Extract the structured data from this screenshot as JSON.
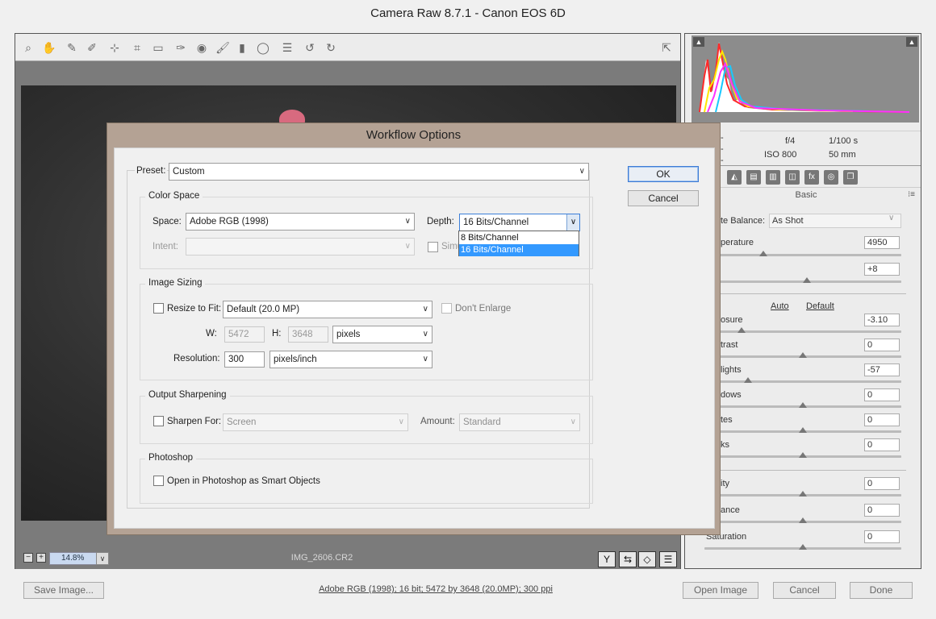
{
  "window": {
    "title": "Camera Raw 8.7.1  -  Canon EOS 6D"
  },
  "toolbar": {
    "tools": [
      {
        "name": "zoom-tool-icon",
        "glyph": "⌕"
      },
      {
        "name": "hand-tool-icon",
        "glyph": "✋"
      },
      {
        "name": "white-balance-tool-icon",
        "glyph": "✎"
      },
      {
        "name": "color-sampler-tool-icon",
        "glyph": "✐"
      },
      {
        "name": "targeted-adjustment-tool-icon",
        "glyph": "⊹"
      },
      {
        "name": "crop-tool-icon",
        "glyph": "⌗"
      },
      {
        "name": "straighten-tool-icon",
        "glyph": "▭"
      },
      {
        "name": "spot-removal-tool-icon",
        "glyph": "✑"
      },
      {
        "name": "red-eye-removal-icon",
        "glyph": "◉"
      },
      {
        "name": "adjustment-brush-icon",
        "glyph": "🖌"
      },
      {
        "name": "graduated-filter-icon",
        "glyph": "▮"
      },
      {
        "name": "radial-filter-icon",
        "glyph": "◯"
      },
      {
        "name": "preferences-icon",
        "glyph": "☰"
      },
      {
        "name": "rotate-left-icon",
        "glyph": "↺"
      },
      {
        "name": "rotate-right-icon",
        "glyph": "↻"
      }
    ],
    "fullscreen_glyph": "⇱"
  },
  "preview": {
    "zoom_minus": "−",
    "zoom_plus": "+",
    "zoom_level": "14.8%",
    "zoom_dropdown": "∨",
    "filename": "IMG_2606.CR2",
    "status_icons": [
      "Y",
      "⇆",
      "◇",
      "☰"
    ]
  },
  "camera_info": {
    "dash1": "-",
    "dash2": "-",
    "dash3": "-",
    "aperture": "f/4",
    "shutter": "1/100 s",
    "iso": "ISO 800",
    "focal": "50 mm"
  },
  "right_panel": {
    "clip_left": "▲",
    "clip_right": "▲",
    "panel_title": "Basic",
    "panel_menu": "⁝≡",
    "tab_glyphs": [
      "◭",
      "▤",
      "▥",
      "◫",
      "fx",
      "◎",
      "❐"
    ],
    "wb_label": "te Balance:",
    "wb_value": "As Shot",
    "wb_arrow": "∨",
    "temp_label": "perature",
    "temp_value": "4950",
    "tint_value": "+8",
    "auto_link": "Auto",
    "default_link": "Default",
    "exposure_label": "osure",
    "exposure_value": "-3.10",
    "contrast_label": "trast",
    "contrast_value": "0",
    "highlights_label": "lights",
    "highlights_value": "-57",
    "shadows_label": "dows",
    "shadows_value": "0",
    "whites_label": "tes",
    "whites_value": "0",
    "blacks_label": "ks",
    "blacks_value": "0",
    "clarity_label": "ity",
    "clarity_value": "0",
    "vibrance_label": "ance",
    "vibrance_value": "0",
    "saturation_label": "Saturation",
    "saturation_value": "0",
    "slider_levels": {
      "temperature": 0.3,
      "tint": 0.52,
      "exposure": 0.19,
      "contrast": 0.5,
      "highlights": 0.22,
      "shadows": 0.5,
      "whites": 0.5,
      "blacks": 0.5,
      "clarity": 0.5,
      "vibrance": 0.5,
      "saturation": 0.5
    }
  },
  "bottom_bar": {
    "save_image": "Save Image...",
    "info_link": "Adobe RGB (1998); 16 bit; 5472 by 3648 (20.0MP); 300 ppi",
    "open_image": "Open Image",
    "cancel": "Cancel",
    "done": "Done"
  },
  "dialog": {
    "title": "Workflow Options",
    "preset_label": "Preset:",
    "preset_value": "Custom",
    "ok": "OK",
    "cancel": "Cancel",
    "arrow": "∨",
    "color_space": {
      "title": "Color Space",
      "space_label": "Space:",
      "space_value": "Adobe RGB (1998)",
      "depth_label": "Depth:",
      "depth_value": "16 Bits/Channel",
      "depth_options": [
        "8 Bits/Channel",
        "16 Bits/Channel"
      ],
      "intent_label": "Intent:",
      "simulate_label": "Simu"
    },
    "image_sizing": {
      "title": "Image Sizing",
      "resize_label": "Resize to Fit:",
      "resize_value": "Default  (20.0 MP)",
      "dont_enlarge": "Don't Enlarge",
      "w_label": "W:",
      "w_value": "5472",
      "h_label": "H:",
      "h_value": "3648",
      "unit_value": "pixels",
      "resolution_label": "Resolution:",
      "resolution_value": "300",
      "resolution_unit": "pixels/inch"
    },
    "output_sharpening": {
      "title": "Output Sharpening",
      "sharpen_label": "Sharpen For:",
      "sharpen_value": "Screen",
      "amount_label": "Amount:",
      "amount_value": "Standard"
    },
    "photoshop": {
      "title": "Photoshop",
      "smart_objects_label": "Open in Photoshop as Smart Objects"
    }
  }
}
